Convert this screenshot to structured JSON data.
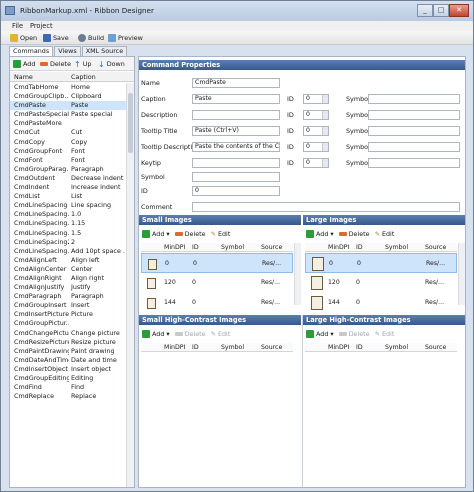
{
  "window": {
    "title": "RibbonMarkup.xml - Ribbon Designer",
    "minimize": "_",
    "maximize": "□",
    "close": "✕"
  },
  "menu": [
    "File",
    "Project"
  ],
  "toolbar": [
    {
      "label": "Open",
      "icon": "folder-open-icon",
      "color": "#e2b33c"
    },
    {
      "label": "Save",
      "icon": "save-icon",
      "color": "#3f68b8"
    },
    {
      "label": "Build",
      "icon": "build-icon",
      "color": "#6d7d90"
    },
    {
      "label": "Preview",
      "icon": "preview-icon",
      "color": "#6aa0d6"
    }
  ],
  "tabs": [
    "Commands",
    "Views",
    "XML Source"
  ],
  "commands_toolbar": {
    "add": "Add",
    "delete": "Delete",
    "up": "Up",
    "down": "Down"
  },
  "commands_columns": {
    "name": "Name",
    "caption": "Caption"
  },
  "commands": [
    [
      "CmdTabHome",
      "Home"
    ],
    [
      "CmdGroupClipb...",
      "Clipboard"
    ],
    [
      "CmdPaste",
      "Paste"
    ],
    [
      "CmdPasteSpecial",
      "Paste special"
    ],
    [
      "CmdPasteMore",
      ""
    ],
    [
      "CmdCut",
      "Cut"
    ],
    [
      "CmdCopy",
      "Copy"
    ],
    [
      "CmdGroupFont",
      "Font"
    ],
    [
      "CmdFont",
      "Font"
    ],
    [
      "CmdGroupParag...",
      "Paragraph"
    ],
    [
      "CmdOutdent",
      "Decrease indent"
    ],
    [
      "CmdIndent",
      "Increase indent"
    ],
    [
      "CmdList",
      "List"
    ],
    [
      "CmdLineSpacing",
      "Line spacing"
    ],
    [
      "CmdLineSpacing...",
      "1.0"
    ],
    [
      "CmdLineSpacing...",
      "1.15"
    ],
    [
      "CmdLineSpacing...",
      "1.5"
    ],
    [
      "CmdLineSpacing2",
      "2"
    ],
    [
      "CmdLineSpacing...",
      "Add 10pt space ..."
    ],
    [
      "CmdAlignLeft",
      "Align left"
    ],
    [
      "CmdAlignCenter",
      "Center"
    ],
    [
      "CmdAlignRight",
      "Align right"
    ],
    [
      "CmdAlignJustify",
      "Justify"
    ],
    [
      "CmdParagraph",
      "Paragraph"
    ],
    [
      "CmdGroupInsert",
      "Insert"
    ],
    [
      "CmdInsertPicture",
      "Picture"
    ],
    [
      "CmdGroupPictur...",
      ""
    ],
    [
      "CmdChangePicture",
      "Change picture"
    ],
    [
      "CmdResizePicture",
      "Resize picture"
    ],
    [
      "CmdPaintDrawing",
      "Paint drawing"
    ],
    [
      "CmdDateAndTime",
      "Date and time"
    ],
    [
      "CmdInsertObject",
      "Insert object"
    ],
    [
      "CmdGroupEditing",
      "Editing"
    ],
    [
      "CmdFind",
      "Find"
    ],
    [
      "CmdReplace",
      "Replace"
    ]
  ],
  "selected_index": 2,
  "properties": {
    "header": "Command Properties",
    "name_label": "Name",
    "name_value": "CmdPaste",
    "caption_label": "Caption",
    "caption_value": "Paste",
    "description_label": "Description",
    "description_value": "",
    "tooltip_title_label": "Tooltip Title",
    "tooltip_title_value": "Paste (Ctrl+V)",
    "tooltip_desc_label": "Tooltip Description",
    "tooltip_desc_value": "Paste the contents of the Clipboa",
    "keytip_label": "Keytip",
    "keytip_value": "",
    "symbol_label": "Symbol",
    "symbol_value": "",
    "id_label": "ID",
    "id_value": "0",
    "comment_label": "Comment",
    "comment_value": "",
    "sub_id_label": "ID",
    "sub_id_value": "0",
    "sub_symbol_label": "Symbol",
    "sub_symbol_value": ""
  },
  "images": {
    "small_header": "Small Images",
    "large_header": "Large Images",
    "small_hc_header": "Small High-Contrast Images",
    "large_hc_header": "Large High-Contrast Images",
    "add": "Add",
    "delete": "Delete",
    "edit": "Edit",
    "columns": {
      "mindpi": "MinDPI",
      "id": "ID",
      "symbol": "Symbol",
      "source": "Source"
    },
    "small_rows": [
      {
        "mindpi": "0",
        "id": "0",
        "source": "Res/..."
      },
      {
        "mindpi": "120",
        "id": "0",
        "source": "Res/..."
      },
      {
        "mindpi": "144",
        "id": "0",
        "source": "Res/..."
      }
    ],
    "large_rows": [
      {
        "mindpi": "0",
        "id": "0",
        "source": "Res/..."
      },
      {
        "mindpi": "120",
        "id": "0",
        "source": "Res/..."
      },
      {
        "mindpi": "144",
        "id": "0",
        "source": "Res/..."
      }
    ]
  },
  "colors": {
    "header_blue": "#37598a",
    "selection": "#cde4fb",
    "add_green": "#2e9b3a",
    "delete_orange": "#e06a2a",
    "arrow_blue": "#2f6fd0"
  }
}
